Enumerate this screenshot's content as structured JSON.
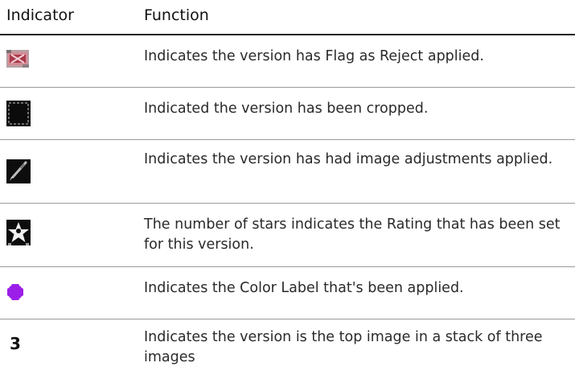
{
  "header": {
    "indicator_label": "Indicator",
    "function_label": "Function"
  },
  "rows": [
    {
      "icon": "flag-reject-icon",
      "text": "Indicates the version has Flag as Reject applied."
    },
    {
      "icon": "crop-icon",
      "text": "Indicated the version has been cropped."
    },
    {
      "icon": "image-adjustments-brush-icon",
      "text": "Indicates the version has had image adjustments applied."
    },
    {
      "icon": "rating-star-icon",
      "text": "The number of stars indicates the Rating that has been set for this version."
    },
    {
      "icon": "color-label-icon",
      "text": "Indicates the Color Label that's been applied.",
      "color": "#9b1fe8"
    },
    {
      "icon_text": "3",
      "text": "Indicates the version is the top image in a stack of three images"
    }
  ]
}
